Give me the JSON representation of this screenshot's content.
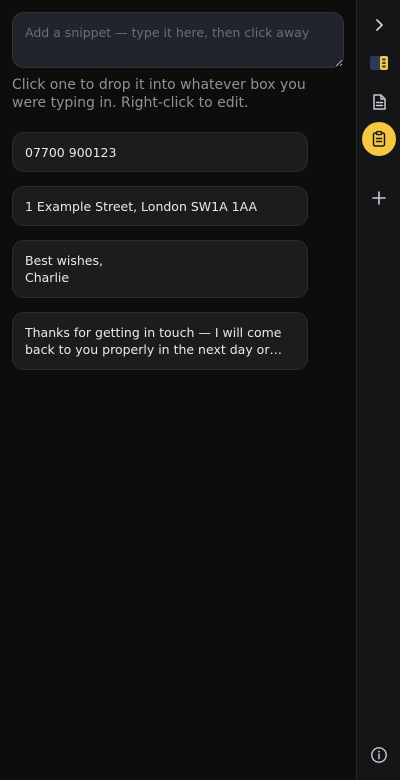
{
  "composer": {
    "placeholder": "Add a snippet — type it here, then click away",
    "value": ""
  },
  "hint": "Click one to drop it into whatever box you were typing in. Right-click to edit.",
  "snippets": [
    {
      "text": "07700 900123"
    },
    {
      "text": "1 Example Street, London SW1A 1AA"
    },
    {
      "text": "Best wishes,\nCharlie"
    },
    {
      "text": "Thanks for getting in touch — I will come back to you properly in the next day or two, once I have …"
    }
  ],
  "rail": {
    "items": [
      {
        "icon": "chevron-right-icon"
      },
      {
        "icon": "split-panel-icon",
        "accent": "#f6c741"
      },
      {
        "icon": "document-icon"
      },
      {
        "icon": "clipboard-icon",
        "active": true
      },
      {
        "icon": "plus-icon"
      },
      {
        "icon": "info-icon"
      }
    ]
  },
  "colors": {
    "accent": "#f6c741",
    "background": "#0d0d0e",
    "card": "#1c1c1f",
    "rail": "#151517"
  }
}
